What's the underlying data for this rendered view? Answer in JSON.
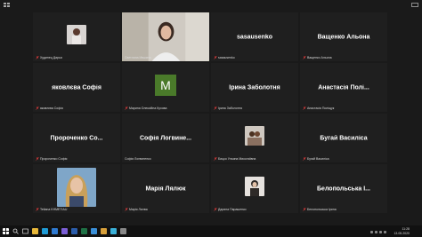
{
  "window": {
    "topleft_icon": "grid-view-icon",
    "topright_icon": "fullscreen-icon"
  },
  "colors": {
    "active_border": "#9acd32",
    "mic_muted": "#e23b3b",
    "avatar_bg": "#4a7a2a"
  },
  "tiles": [
    {
      "big": "",
      "label": "Худинец Дарья",
      "muted": true,
      "thumb": "photo"
    },
    {
      "big": "",
      "label": "Светлана Ившина",
      "muted": false,
      "thumb": "video"
    },
    {
      "big": "sasausenko",
      "label": "sasausenko",
      "muted": true
    },
    {
      "big": "Ващенко Альона",
      "label": "Ващенко Альона",
      "muted": true
    },
    {
      "big": "яковлєва Софія",
      "label": "яковлєва Софія",
      "muted": true
    },
    {
      "big": "",
      "label": "Марина Олексійна Кухова",
      "muted": true,
      "avatar": "M"
    },
    {
      "big": "Ірина Заболотня",
      "label": "Ірина Заболотня",
      "muted": true
    },
    {
      "big": "Анастасія Полі...",
      "label": "Анастасія Поліщук",
      "muted": true
    },
    {
      "big": "Пророченко Со...",
      "label": "Пророченко Софія",
      "muted": true
    },
    {
      "big": "Софія Логвине...",
      "label": "Софія Логвиненко",
      "muted": false
    },
    {
      "big": "",
      "label": "Бицко Ульяна Миколаївна",
      "muted": true,
      "thumb": "photo"
    },
    {
      "big": "Бугай Василіса",
      "label": "Бугай Василіса",
      "muted": true
    },
    {
      "big": "",
      "label": "Tetiana KHMETIAU",
      "muted": true,
      "thumb": "portrait"
    },
    {
      "big": "Марія Лялюк",
      "label": "Марія Лялюк",
      "muted": true
    },
    {
      "big": "",
      "label": "Дарина Парашенко",
      "muted": true,
      "thumb": "photo"
    },
    {
      "big": "Белопольська І...",
      "label": "Белопольська Ірина",
      "muted": true
    }
  ],
  "taskbar": {
    "icons": [
      "windows-icon",
      "search-icon",
      "task-view-icon",
      "explorer-icon",
      "chrome-icon",
      "mail-icon",
      "zoom-icon",
      "word-icon",
      "excel-icon",
      "store-icon",
      "photos-icon",
      "media-icon",
      "settings-icon"
    ],
    "time": "11:28",
    "date": "13.05.2020"
  }
}
